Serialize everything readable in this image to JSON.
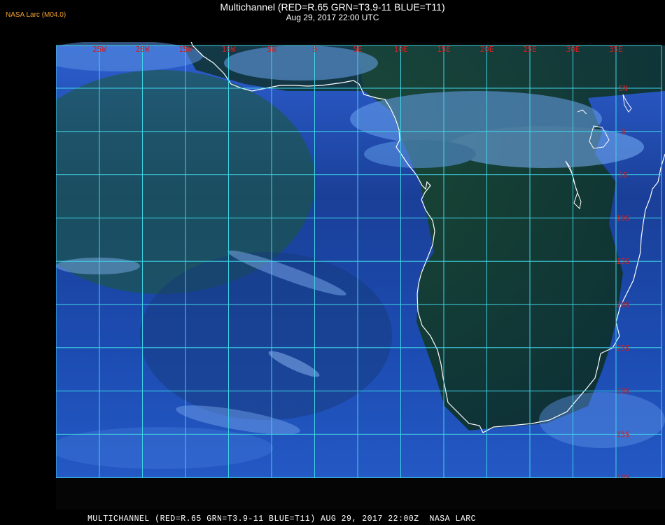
{
  "header": {
    "badge": "NASA Larc (M04.0)",
    "title": "Multichannel (RED=R.65 GRN=T3.9-11 BLUE=T11)",
    "subtitle": "Aug 29, 2017 22:00 UTC"
  },
  "map": {
    "longitude_labels": [
      "25W",
      "20W",
      "15W",
      "10W",
      "5W",
      "0",
      "5E",
      "10E",
      "15E",
      "20E",
      "25E",
      "30E",
      "35E"
    ],
    "latitude_labels": [
      "5N",
      "0",
      "5S",
      "10S",
      "15S",
      "20S",
      "25S",
      "30S",
      "35S",
      "40S"
    ],
    "colors": {
      "grid": "#3fd4e6",
      "coastline": "#ffffff",
      "labels": "#d02020",
      "ocean": "#1a47a8",
      "land": "#0d3a22"
    }
  },
  "footer": {
    "text": "MULTICHANNEL (RED=R.65 GRN=T3.9-11 BLUE=T11) AUG 29, 2017 22:00Z  NASA LARC"
  }
}
